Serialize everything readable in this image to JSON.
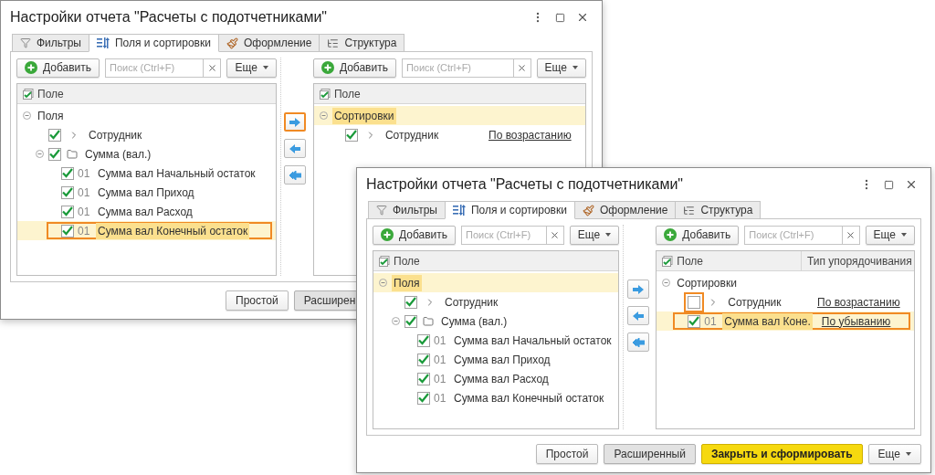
{
  "windows": [
    {
      "title": "Настройки отчета \"Расчеты с подотчетниками\"",
      "tabs": [
        {
          "label": "Фильтры",
          "kind": "filter",
          "selected": false
        },
        {
          "label": "Поля и сортировки",
          "kind": "fields",
          "selected": true
        },
        {
          "label": "Оформление",
          "kind": "design",
          "selected": false
        },
        {
          "label": "Структура",
          "kind": "structure",
          "selected": false
        }
      ],
      "left_panel": {
        "add_button": "Добавить",
        "search": {
          "placeholder": "Поиск (Ctrl+F)"
        },
        "more_button": "Еще",
        "columns": [
          "Поле"
        ],
        "tree": [
          {
            "label": "Поля",
            "kind": "root",
            "expanded": true,
            "selected": false,
            "children": [
              {
                "label": "Сотрудник",
                "kind": "reference",
                "checked": true,
                "selected": false
              },
              {
                "label": "Сумма (вал.)",
                "kind": "folder",
                "checked": true,
                "expanded": true,
                "selected": false,
                "children": [
                  {
                    "label": "Сумма вал Начальный остаток",
                    "kind": "field",
                    "code": "01",
                    "checked": true,
                    "selected": false
                  },
                  {
                    "label": "Сумма вал Приход",
                    "kind": "field",
                    "code": "01",
                    "checked": true,
                    "selected": false
                  },
                  {
                    "label": "Сумма вал Расход",
                    "kind": "field",
                    "code": "01",
                    "checked": true,
                    "selected": false
                  },
                  {
                    "label": "Сумма вал Конечный остаток",
                    "kind": "field",
                    "code": "01",
                    "checked": true,
                    "selected": true,
                    "outlined": true
                  }
                ]
              }
            ]
          }
        ]
      },
      "move_buttons": [
        {
          "kind": "add",
          "outlined": true
        },
        {
          "kind": "remove",
          "outlined": false
        },
        {
          "kind": "remove_all",
          "outlined": false
        }
      ],
      "right_panel": {
        "add_button": "Добавить",
        "search": {
          "placeholder": "Поиск (Ctrl+F)"
        },
        "more_button": "Еще",
        "columns": [
          "Поле"
        ],
        "tree": [
          {
            "label": "Сортировки",
            "kind": "root",
            "expanded": true,
            "selected": true,
            "children": [
              {
                "label": "Сотрудник",
                "kind": "reference",
                "checked": true,
                "order": "По возрастанию",
                "selected": false
              }
            ]
          }
        ]
      },
      "footer_buttons": [
        {
          "label": "Простой",
          "kind": "normal"
        },
        {
          "label": "Расширен",
          "kind": "pressed"
        }
      ]
    },
    {
      "title": "Настройки отчета \"Расчеты с подотчетниками\"",
      "tabs": [
        {
          "label": "Фильтры",
          "kind": "filter",
          "selected": false
        },
        {
          "label": "Поля и сортировки",
          "kind": "fields",
          "selected": true
        },
        {
          "label": "Оформление",
          "kind": "design",
          "selected": false
        },
        {
          "label": "Структура",
          "kind": "structure",
          "selected": false
        }
      ],
      "left_panel": {
        "add_button": "Добавить",
        "search": {
          "placeholder": "Поиск (Ctrl+F)"
        },
        "more_button": "Еще",
        "columns": [
          "Поле"
        ],
        "tree": [
          {
            "label": "Поля",
            "kind": "root",
            "expanded": true,
            "selected": true,
            "children": [
              {
                "label": "Сотрудник",
                "kind": "reference",
                "checked": true,
                "selected": false
              },
              {
                "label": "Сумма (вал.)",
                "kind": "folder",
                "checked": true,
                "expanded": true,
                "selected": false,
                "children": [
                  {
                    "label": "Сумма вал Начальный остаток",
                    "kind": "field",
                    "code": "01",
                    "checked": true,
                    "selected": false
                  },
                  {
                    "label": "Сумма вал Приход",
                    "kind": "field",
                    "code": "01",
                    "checked": true,
                    "selected": false
                  },
                  {
                    "label": "Сумма вал Расход",
                    "kind": "field",
                    "code": "01",
                    "checked": true,
                    "selected": false
                  },
                  {
                    "label": "Сумма вал Конечный остаток",
                    "kind": "field",
                    "code": "01",
                    "checked": true,
                    "selected": false
                  }
                ]
              }
            ]
          }
        ]
      },
      "move_buttons": [
        {
          "kind": "add",
          "outlined": false
        },
        {
          "kind": "remove",
          "outlined": false
        },
        {
          "kind": "remove_all",
          "outlined": false
        }
      ],
      "right_panel": {
        "add_button": "Добавить",
        "search": {
          "placeholder": "Поиск (Ctrl+F)"
        },
        "more_button": "Еще",
        "columns": [
          "Поле",
          "Тип упорядочивания"
        ],
        "tree": [
          {
            "label": "Сортировки",
            "kind": "root",
            "expanded": true,
            "selected": false,
            "children": [
              {
                "label": "Сотрудник",
                "kind": "reference",
                "checked": false,
                "order": "По возрастанию",
                "selected": false,
                "checkbox_outlined": true
              },
              {
                "label": "Сумма вал Коне.",
                "kind": "field",
                "code": "01",
                "checked": true,
                "order": "По убыванию",
                "selected": true,
                "outlined": true
              }
            ]
          }
        ]
      },
      "footer_buttons": [
        {
          "label": "Простой",
          "kind": "normal"
        },
        {
          "label": "Расширенный",
          "kind": "pressed"
        },
        {
          "label": "Закрыть и сформировать",
          "kind": "default"
        },
        {
          "label": "Еще",
          "kind": "menu"
        }
      ]
    }
  ]
}
